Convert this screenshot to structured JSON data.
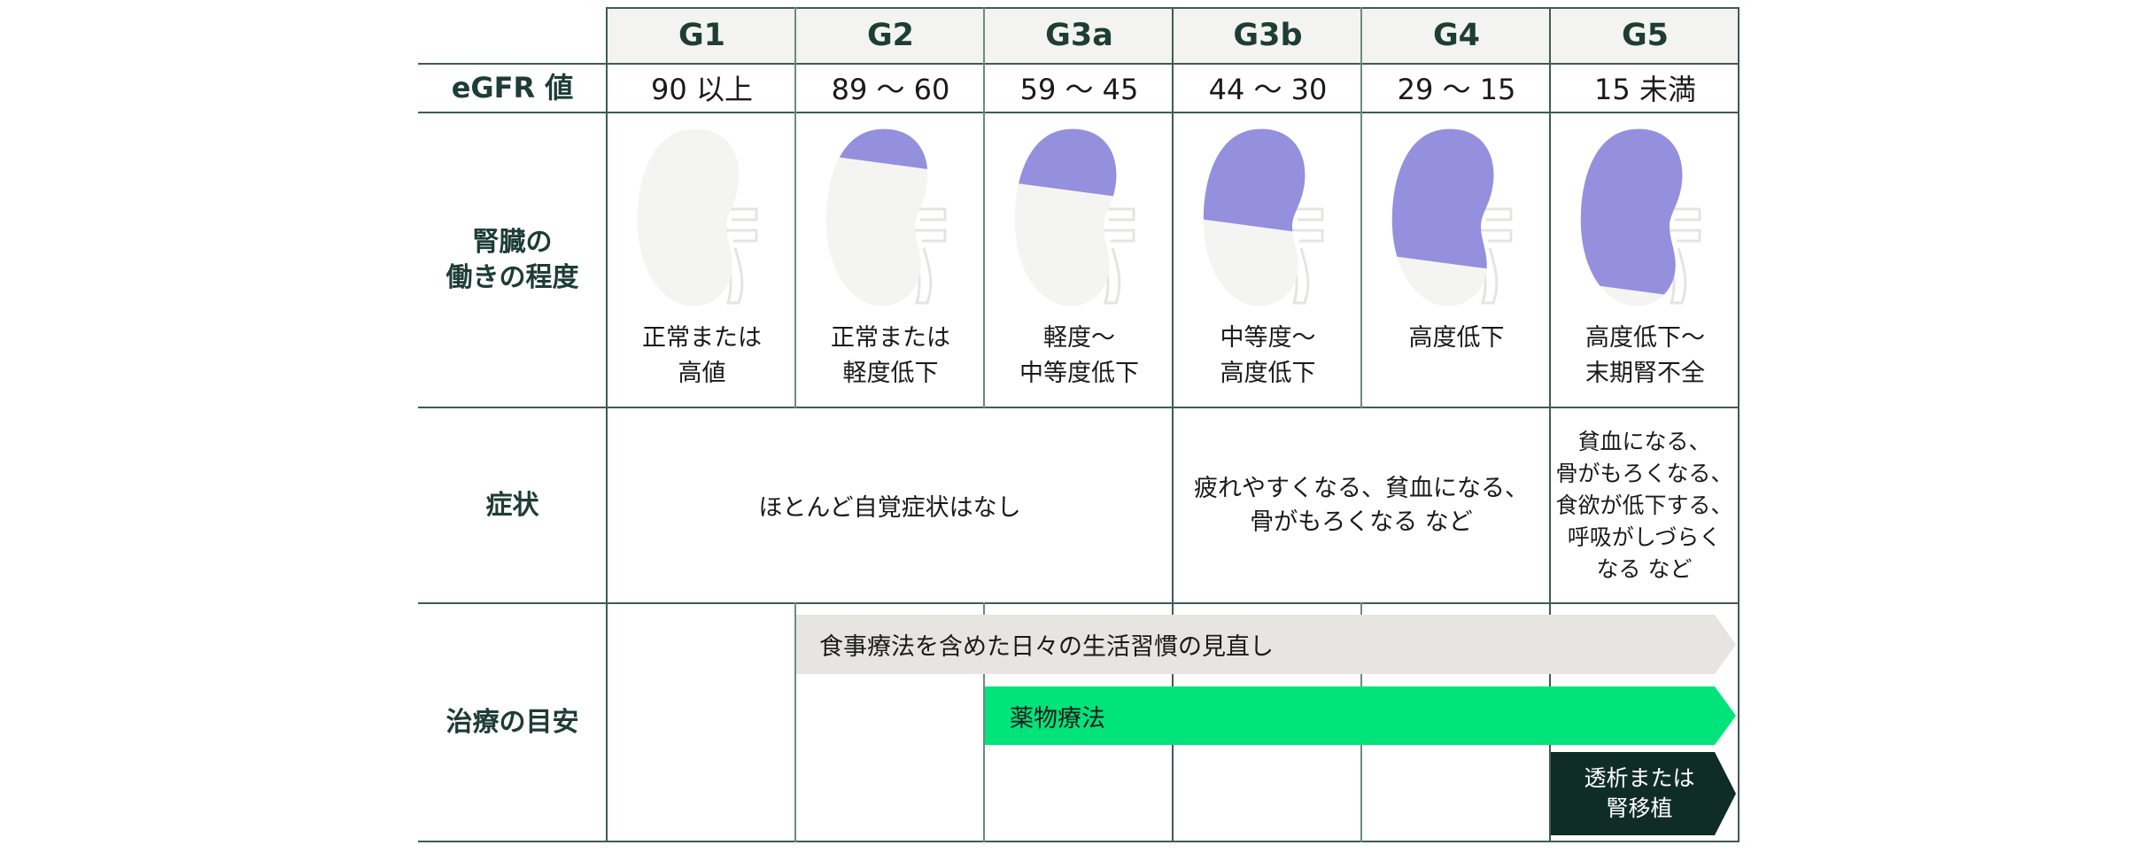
{
  "header": {
    "stages": [
      "G1",
      "G2",
      "G3a",
      "G3b",
      "G4",
      "G5"
    ]
  },
  "egfr": {
    "label": "eGFR 値",
    "values": [
      "90 以上",
      "89 ～ 60",
      "59 ～ 45",
      "44 ～ 30",
      "29 ～ 15",
      "15 未満"
    ]
  },
  "function": {
    "label_line1": "腎臓の",
    "label_line2": "働きの程度",
    "descriptions": [
      [
        "正常または",
        "高値"
      ],
      [
        "正常または",
        "軽度低下"
      ],
      [
        "軽度～",
        "中等度低下"
      ],
      [
        "中等度～",
        "高度低下"
      ],
      [
        "高度低下"
      ],
      [
        "高度低下～",
        "末期腎不全"
      ]
    ],
    "impairment_levels": [
      0,
      0.2,
      0.35,
      0.55,
      0.75,
      0.9
    ]
  },
  "symptoms": {
    "label": "症状",
    "g1_g3a": "ほとんど自覚症状はなし",
    "g3b_g4_line1": "疲れやすくなる、貧血になる、",
    "g3b_g4_line2": "骨がもろくなる など",
    "g5_lines": [
      "貧血になる、",
      "骨がもろくなる、",
      "食欲が低下する、",
      "呼吸がしづらく",
      "なる など"
    ]
  },
  "treatment": {
    "label": "治療の目安",
    "diet": "食事療法を含めた日々の生活習慣の見直し",
    "medication": "薬物療法",
    "dialysis_line1": "透析または",
    "dialysis_line2": "腎移植"
  },
  "colors": {
    "grid": "#3e5c52",
    "header_text": "#1e3d34",
    "kidney_fill": "#9490de",
    "kidney_base": "#f4f4f3",
    "diet_bar": "#e6e5e2",
    "medication_bar": "#00e47b",
    "dialysis_bar": "#0f2d25"
  }
}
